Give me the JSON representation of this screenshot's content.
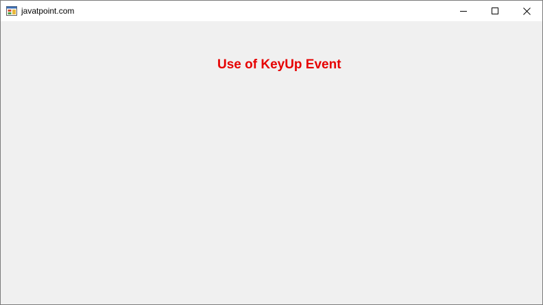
{
  "window": {
    "title": "javatpoint.com",
    "icon": "form-app-icon",
    "controls": {
      "minimize_icon": "minimize-icon",
      "maximize_icon": "maximize-icon",
      "close_icon": "close-icon"
    }
  },
  "form": {
    "heading": "Use of KeyUp Event",
    "heading_color": "#e60000",
    "background_color": "#f0f0f0"
  }
}
